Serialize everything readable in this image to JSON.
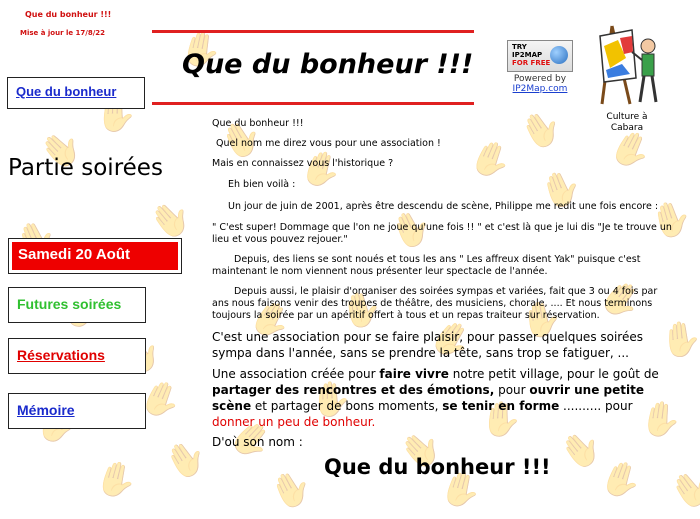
{
  "site": {
    "top_title": "Que du bonheur !!!",
    "update_text": "Mise à jour le 17/8/22",
    "header_title": "Que du bonheur !!!"
  },
  "ip2map": {
    "badge_line1": "TRY",
    "badge_line2": "IP2MAP",
    "badge_line3": "FOR FREE",
    "powered": "Powered by",
    "link": "IP2Map.com"
  },
  "clipart": {
    "caption_line1": "Culture à",
    "caption_line2": "Cabara"
  },
  "nav": {
    "home": "Que du bonheur",
    "section_title": "Partie soirées",
    "current": "Samedi 20 Août",
    "future": "Futures soirées",
    "reservations": "Réservations",
    "memory": "Mémoire"
  },
  "content": {
    "p1": "Que du bonheur !!!",
    "p2": "Quel nom me direz vous pour une association !",
    "p3": "Mais en connaissez vous l'historique ?",
    "p4": "Eh bien voilà :",
    "p5": "Un jour de juin de 2001, après être descendu de scène, Philippe me redit une fois encore :",
    "p6": "\" C'est super! Dommage que l'on ne joue qu'une fois !! \" et c'est là que je lui dis  \"Je te trouve un lieu et vous pouvez rejouer.\"",
    "p7": "Depuis, des liens se sont noués et tous les ans \" Les affreux disent Yak\" puisque c'est maintenant le nom viennent nous présenter leur spectacle de l'année.",
    "p8": "Depuis aussi, le plaisir d'organiser des soirées sympas et variées, fait que 3 ou 4 fois par ans nous faisons venir des troupes de théâtre, des musiciens, chorale, .... Et nous terminons toujours la soirée par un apéritif offert à tous et un repas traiteur sur réservation.",
    "p9": "C'est une association pour se faire plaisir, pour passer quelques soirées sympa dans l'année, sans se prendre la tête, sans trop se fatiguer, ...",
    "p10a": "Une association créée pour ",
    "p10b": "faire vivre",
    "p10c": " notre petit village, pour le goût de ",
    "p10d": "partager des rencontres et des émotions,",
    "p10e": " pour ",
    "p10f": "ouvrir une petite scène",
    "p10g": " et partager de bons moments, ",
    "p10h": "se tenir en forme",
    "p10i": " .......... pour ",
    "p10j": "donner un peu de bonheur.",
    "p11": "D'où son nom  :",
    "footer_title": "Que du bonheur !!!"
  },
  "colors": {
    "accent_red": "#e00000",
    "link_blue": "#1a2acc",
    "green": "#30c030"
  }
}
